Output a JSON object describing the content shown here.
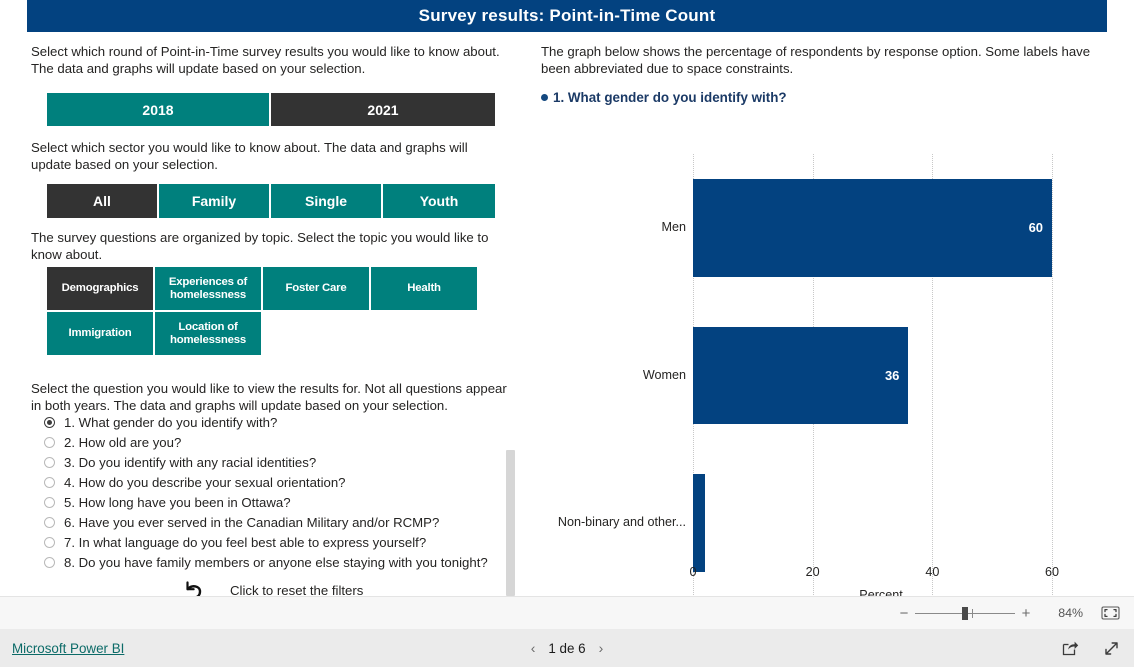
{
  "header": {
    "title": "Survey results: Point-in-Time Count"
  },
  "left": {
    "help_round": "Select which round of Point-in-Time survey results you would like to know about. The data and graphs will update based on your selection.",
    "help_sector": "Select which sector you would like to know about. The data and graphs will update based on your selection.",
    "help_topic": "The survey questions are organized by topic. Select the topic you would like to know about.",
    "help_question": "Select the question you would like to view the results for. Not all questions appear in both years. The data and graphs will update based on your selection.",
    "years": [
      {
        "label": "2018",
        "selected": false
      },
      {
        "label": "2021",
        "selected": true
      }
    ],
    "sectors": [
      {
        "label": "All",
        "selected": true
      },
      {
        "label": "Family",
        "selected": false
      },
      {
        "label": "Single",
        "selected": false
      },
      {
        "label": "Youth",
        "selected": false
      }
    ],
    "topics": [
      {
        "label": "Demographics",
        "selected": true
      },
      {
        "label": "Experiences of homelessness",
        "selected": false
      },
      {
        "label": "Foster Care",
        "selected": false
      },
      {
        "label": "Health",
        "selected": false
      },
      {
        "label": "Immigration",
        "selected": false
      },
      {
        "label": "Location of homelessness",
        "selected": false
      }
    ],
    "questions": [
      {
        "label": "1. What gender do you identify with?",
        "selected": true
      },
      {
        "label": "2. How old are you?",
        "selected": false
      },
      {
        "label": "3. Do you identify with any racial identities?",
        "selected": false
      },
      {
        "label": "4. How do you describe your sexual orientation?",
        "selected": false
      },
      {
        "label": "5. How long have you been in Ottawa?",
        "selected": false
      },
      {
        "label": "6. Have you ever served in the Canadian Military and/or RCMP?",
        "selected": false
      },
      {
        "label": "7. In what language do you feel best able to express yourself?",
        "selected": false
      },
      {
        "label": "8. Do you have family members or anyone else staying with you tonight?",
        "selected": false
      }
    ],
    "reset_label": "Click to reset the filters",
    "reset_icon": "undo-arrow-icon"
  },
  "right": {
    "help_graph": "The graph below shows the percentage of respondents by response option. Some labels have been abbreviated due to space constraints.",
    "question_heading": "1. What gender do you identify with?"
  },
  "chart_data": {
    "type": "bar",
    "orientation": "horizontal",
    "title": "1. What gender do you identify with?",
    "categories": [
      "Men",
      "Women",
      "Non-binary and other..."
    ],
    "values": [
      60,
      36,
      2
    ],
    "value_labels": [
      "60",
      "36",
      ""
    ],
    "xlabel": "Percent",
    "ylabel": "",
    "xlim": [
      0,
      63
    ],
    "xticks": [
      0,
      20,
      40,
      60
    ],
    "xtick_labels": [
      "0",
      "20",
      "40",
      "60"
    ],
    "grid": "vertical-dotted",
    "legend": "none",
    "bar_color": "#034280"
  },
  "zoombar": {
    "minus": "−",
    "plus": "+",
    "percent": "84%",
    "fit_icon": "fit-to-page-icon"
  },
  "footer": {
    "brand": "Microsoft Power BI",
    "prev_icon": "chevron-left-icon",
    "next_icon": "chevron-right-icon",
    "page_label": "1 de 6",
    "share_icon": "share-icon",
    "fullscreen_icon": "fullscreen-icon"
  },
  "colors": {
    "navy": "#034280",
    "teal": "#00807D",
    "dark": "#333333",
    "footer_bg": "#ebebeb",
    "brand_link": "#0c6b68"
  }
}
